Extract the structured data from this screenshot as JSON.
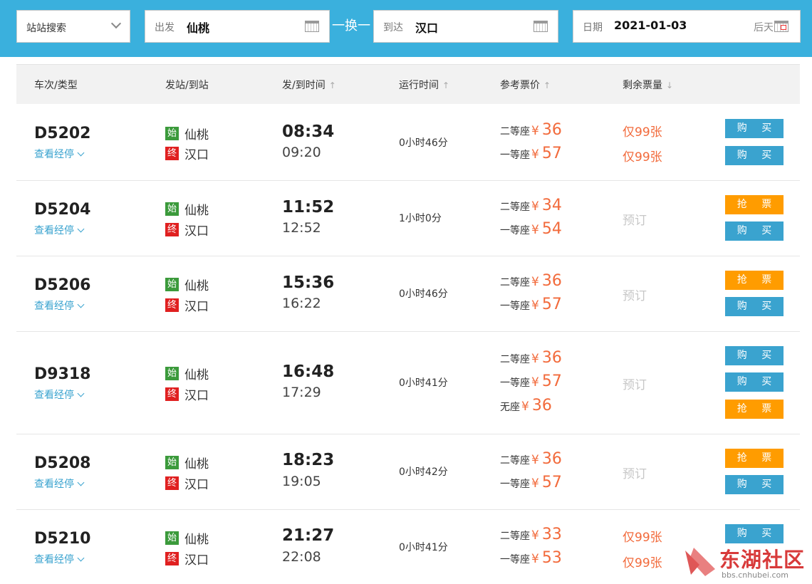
{
  "search": {
    "station_search_label": "站站搜索",
    "from_label": "出发",
    "from_value": "仙桃",
    "swap_label": "一换一",
    "to_label": "到达",
    "to_value": "汉口",
    "date_label": "日期",
    "date_value": "2021-01-03",
    "date_suffix": "后天"
  },
  "table": {
    "headers": {
      "train": "车次/类型",
      "stations": "发站/到站",
      "times": "发/到时间",
      "duration": "运行时间",
      "price": "参考票价",
      "remain": "剩余票量"
    },
    "sort_up": "↑",
    "sort_down": "↓",
    "stops_link": "查看经停",
    "start_tag": "始",
    "end_tag": "终",
    "yen": "¥",
    "rows": [
      {
        "train": "D5202",
        "from": "仙桃",
        "to": "汉口",
        "dep": "08:34",
        "arr": "09:20",
        "duration": "0小时46分",
        "seats": [
          {
            "type": "二等座",
            "price": "36",
            "remain": "仅99张",
            "action": "购 买"
          },
          {
            "type": "一等座",
            "price": "57",
            "remain": "仅99张",
            "action": "购 买"
          }
        ]
      },
      {
        "train": "D5204",
        "from": "仙桃",
        "to": "汉口",
        "dep": "11:52",
        "arr": "12:52",
        "duration": "1小时0分",
        "status": "预订",
        "seats": [
          {
            "type": "二等座",
            "price": "34",
            "action": "抢 票"
          },
          {
            "type": "一等座",
            "price": "54",
            "action": "购 买"
          }
        ]
      },
      {
        "train": "D5206",
        "from": "仙桃",
        "to": "汉口",
        "dep": "15:36",
        "arr": "16:22",
        "duration": "0小时46分",
        "status": "预订",
        "seats": [
          {
            "type": "二等座",
            "price": "36",
            "action": "抢 票"
          },
          {
            "type": "一等座",
            "price": "57",
            "action": "购 买"
          }
        ]
      },
      {
        "train": "D9318",
        "from": "仙桃",
        "to": "汉口",
        "dep": "16:48",
        "arr": "17:29",
        "duration": "0小时41分",
        "status": "预订",
        "seats": [
          {
            "type": "二等座",
            "price": "36",
            "action": "购 买"
          },
          {
            "type": "一等座",
            "price": "57",
            "action": "购 买"
          },
          {
            "type": "无座",
            "price": "36",
            "action": "抢 票"
          }
        ]
      },
      {
        "train": "D5208",
        "from": "仙桃",
        "to": "汉口",
        "dep": "18:23",
        "arr": "19:05",
        "duration": "0小时42分",
        "status": "预订",
        "seats": [
          {
            "type": "二等座",
            "price": "36",
            "action": "抢 票"
          },
          {
            "type": "一等座",
            "price": "57",
            "action": "购 买"
          }
        ]
      },
      {
        "train": "D5210",
        "from": "仙桃",
        "to": "汉口",
        "dep": "21:27",
        "arr": "22:08",
        "duration": "0小时41分",
        "seats": [
          {
            "type": "二等座",
            "price": "33",
            "remain": "仅99张",
            "action": "购 买"
          },
          {
            "type": "一等座",
            "price": "53",
            "remain": "仅99张",
            "action": "购 买"
          }
        ]
      }
    ]
  },
  "watermark": {
    "text": "东湖社区",
    "url": "bbs.cnhubei.com"
  },
  "colors": {
    "topbar": "#3ab0dd",
    "price": "#f26a3b",
    "buy_button": "#3aa3cf",
    "grab_button": "#ff9c00",
    "start_tag": "#3b9a3b",
    "end_tag": "#e02020"
  }
}
